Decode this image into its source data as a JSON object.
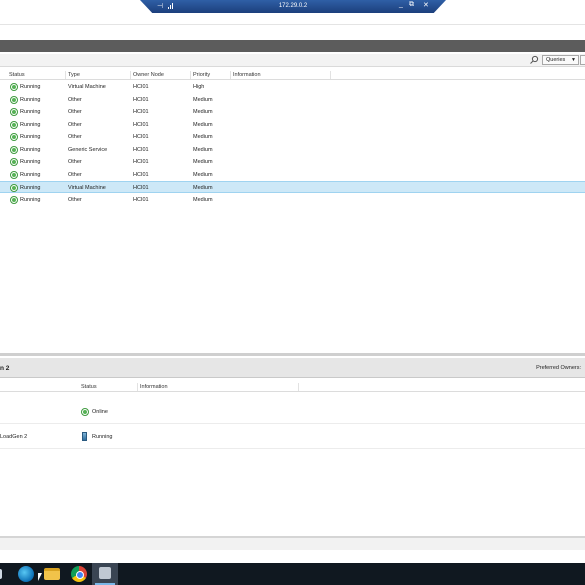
{
  "rdp": {
    "host": "172.29.0.2",
    "pin_glyph": "⊣",
    "minimize": "_",
    "restore": "⧉",
    "close": "✕"
  },
  "toolbar": {
    "queries_label": "Queries",
    "queries_arrow": "▼"
  },
  "roles_grid": {
    "columns": {
      "status": "Status",
      "type": "Type",
      "owner": "Owner Node",
      "priority": "Priority",
      "information": "Information"
    },
    "rows": [
      {
        "status": "Running",
        "type": "Virtual Machine",
        "owner": "HCI01",
        "priority": "High"
      },
      {
        "status": "Running",
        "type": "Other",
        "owner": "HCI01",
        "priority": "Medium"
      },
      {
        "status": "Running",
        "type": "Other",
        "owner": "HCI01",
        "priority": "Medium"
      },
      {
        "status": "Running",
        "type": "Other",
        "owner": "HCI01",
        "priority": "Medium"
      },
      {
        "status": "Running",
        "type": "Other",
        "owner": "HCI01",
        "priority": "Medium"
      },
      {
        "status": "Running",
        "type": "Generic Service",
        "owner": "HCI01",
        "priority": "Medium"
      },
      {
        "status": "Running",
        "type": "Other",
        "owner": "HCI01",
        "priority": "Medium"
      },
      {
        "status": "Running",
        "type": "Other",
        "owner": "HCI01",
        "priority": "Medium"
      },
      {
        "status": "Running",
        "type": "Virtual Machine",
        "owner": "HCI01",
        "priority": "Medium"
      },
      {
        "status": "Running",
        "type": "Other",
        "owner": "HCI01",
        "priority": "Medium"
      }
    ],
    "selected_index": 8
  },
  "detail": {
    "title": "n 2",
    "preferred_owners": "Preferred Owners:",
    "columns": {
      "status": "Status",
      "information": "Information"
    },
    "rows": [
      {
        "name": "",
        "status": "Online",
        "icon": "online-icon"
      },
      {
        "name": "LoadGen 2",
        "status": "Running",
        "icon": "vm-icon"
      }
    ]
  },
  "taskbar": {
    "items": [
      "start-icon",
      "edge-icon",
      "file-explorer-icon",
      "chrome-icon",
      "failover-cluster-manager-icon"
    ]
  }
}
